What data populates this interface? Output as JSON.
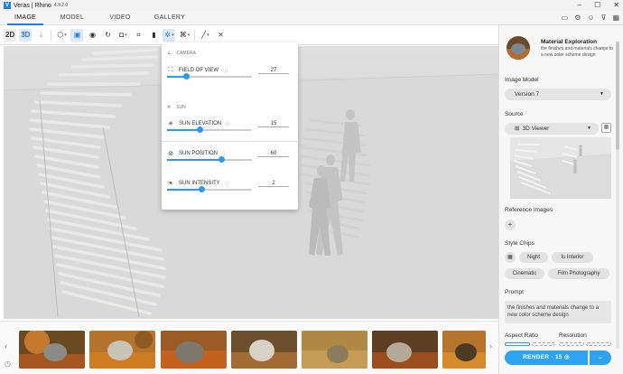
{
  "window": {
    "title": "Veras | Rhino",
    "version": "4.9.2.0",
    "logo": "V"
  },
  "tabs": [
    {
      "label": "IMAGE",
      "active": true
    },
    {
      "label": "MODEL",
      "active": false
    },
    {
      "label": "VIDEO",
      "active": false
    },
    {
      "label": "GALLERY",
      "active": false
    }
  ],
  "toolbar": {
    "mode_2d": "2D",
    "mode_3d": "3D"
  },
  "camera_popup": {
    "camera_section": "CAMERA",
    "sun_section": "SUN",
    "field_of_view": {
      "label": "FIELD OF VIEW",
      "value": "27",
      "fraction": 0.22
    },
    "sun_elevation": {
      "label": "SUN ELEVATION",
      "value": "15",
      "fraction": 0.38
    },
    "sun_position": {
      "label": "SUN POSITION",
      "value": "60",
      "fraction": 0.64
    },
    "sun_intensity": {
      "label": "SUN INTENSITY",
      "value": "2",
      "fraction": 0.4
    }
  },
  "sidebar": {
    "preset_title": "Material Exploration",
    "preset_desc": "the finishes and materials change to a new color scheme design",
    "image_model_label": "Image Model",
    "image_model_value": "Version 7",
    "source_label": "Source",
    "source_value": "3D Viewer",
    "reference_images_label": "Reference Images",
    "style_chips_label": "Style Chips",
    "chips": [
      "Night",
      "Is Interior",
      "Cinematic",
      "Film Photography"
    ],
    "prompt_label": "Prompt",
    "prompt_text": "the finishes and materials change to a new color scheme design",
    "aspect_ratio_label": "Aspect Ratio",
    "resolution_label": "Resolution",
    "render_label": "RENDER · 15"
  },
  "colors": {
    "accent": "#2a9bf0",
    "render": "#2ea3f2"
  }
}
